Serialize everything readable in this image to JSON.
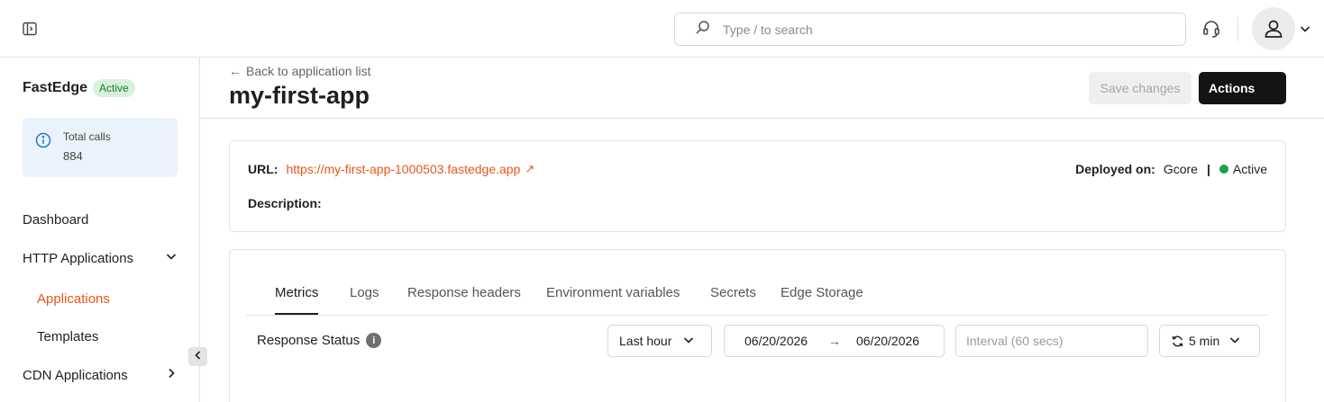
{
  "search": {
    "placeholder": "Type / to search"
  },
  "sidebar": {
    "brand": "FastEdge",
    "brand_badge": "Active",
    "total_calls_label": "Total calls",
    "total_calls_value": "884",
    "nav": {
      "dashboard": "Dashboard",
      "http_applications": "HTTP Applications",
      "applications": "Applications",
      "templates": "Templates",
      "cdn_applications": "CDN Applications"
    }
  },
  "header": {
    "back_label": "Back to application list",
    "title": "my-first-app",
    "save_label": "Save changes",
    "actions_label": "Actions"
  },
  "info": {
    "url_label": "URL:",
    "url_value": "https://my-first-app-1000503.fastedge.app",
    "description_label": "Description:",
    "deployed_label": "Deployed on:",
    "deployed_value": "Gcore",
    "separator": "|",
    "status": "Active"
  },
  "tabs": [
    "Metrics",
    "Logs",
    "Response headers",
    "Environment variables",
    "Secrets",
    "Edge Storage"
  ],
  "filters": {
    "section_label": "Response Status",
    "range": "Last hour",
    "date_from": "06/20/2026",
    "date_to": "06/20/2026",
    "interval_placeholder": "Interval (60 secs)",
    "refresh": "5 min"
  },
  "colors": {
    "accent": "#e8581a",
    "active_badge_bg": "#d7f1dc",
    "active_badge_text": "#1b7a32",
    "status_dot": "#1aa24a",
    "primary_button": "#141414"
  }
}
